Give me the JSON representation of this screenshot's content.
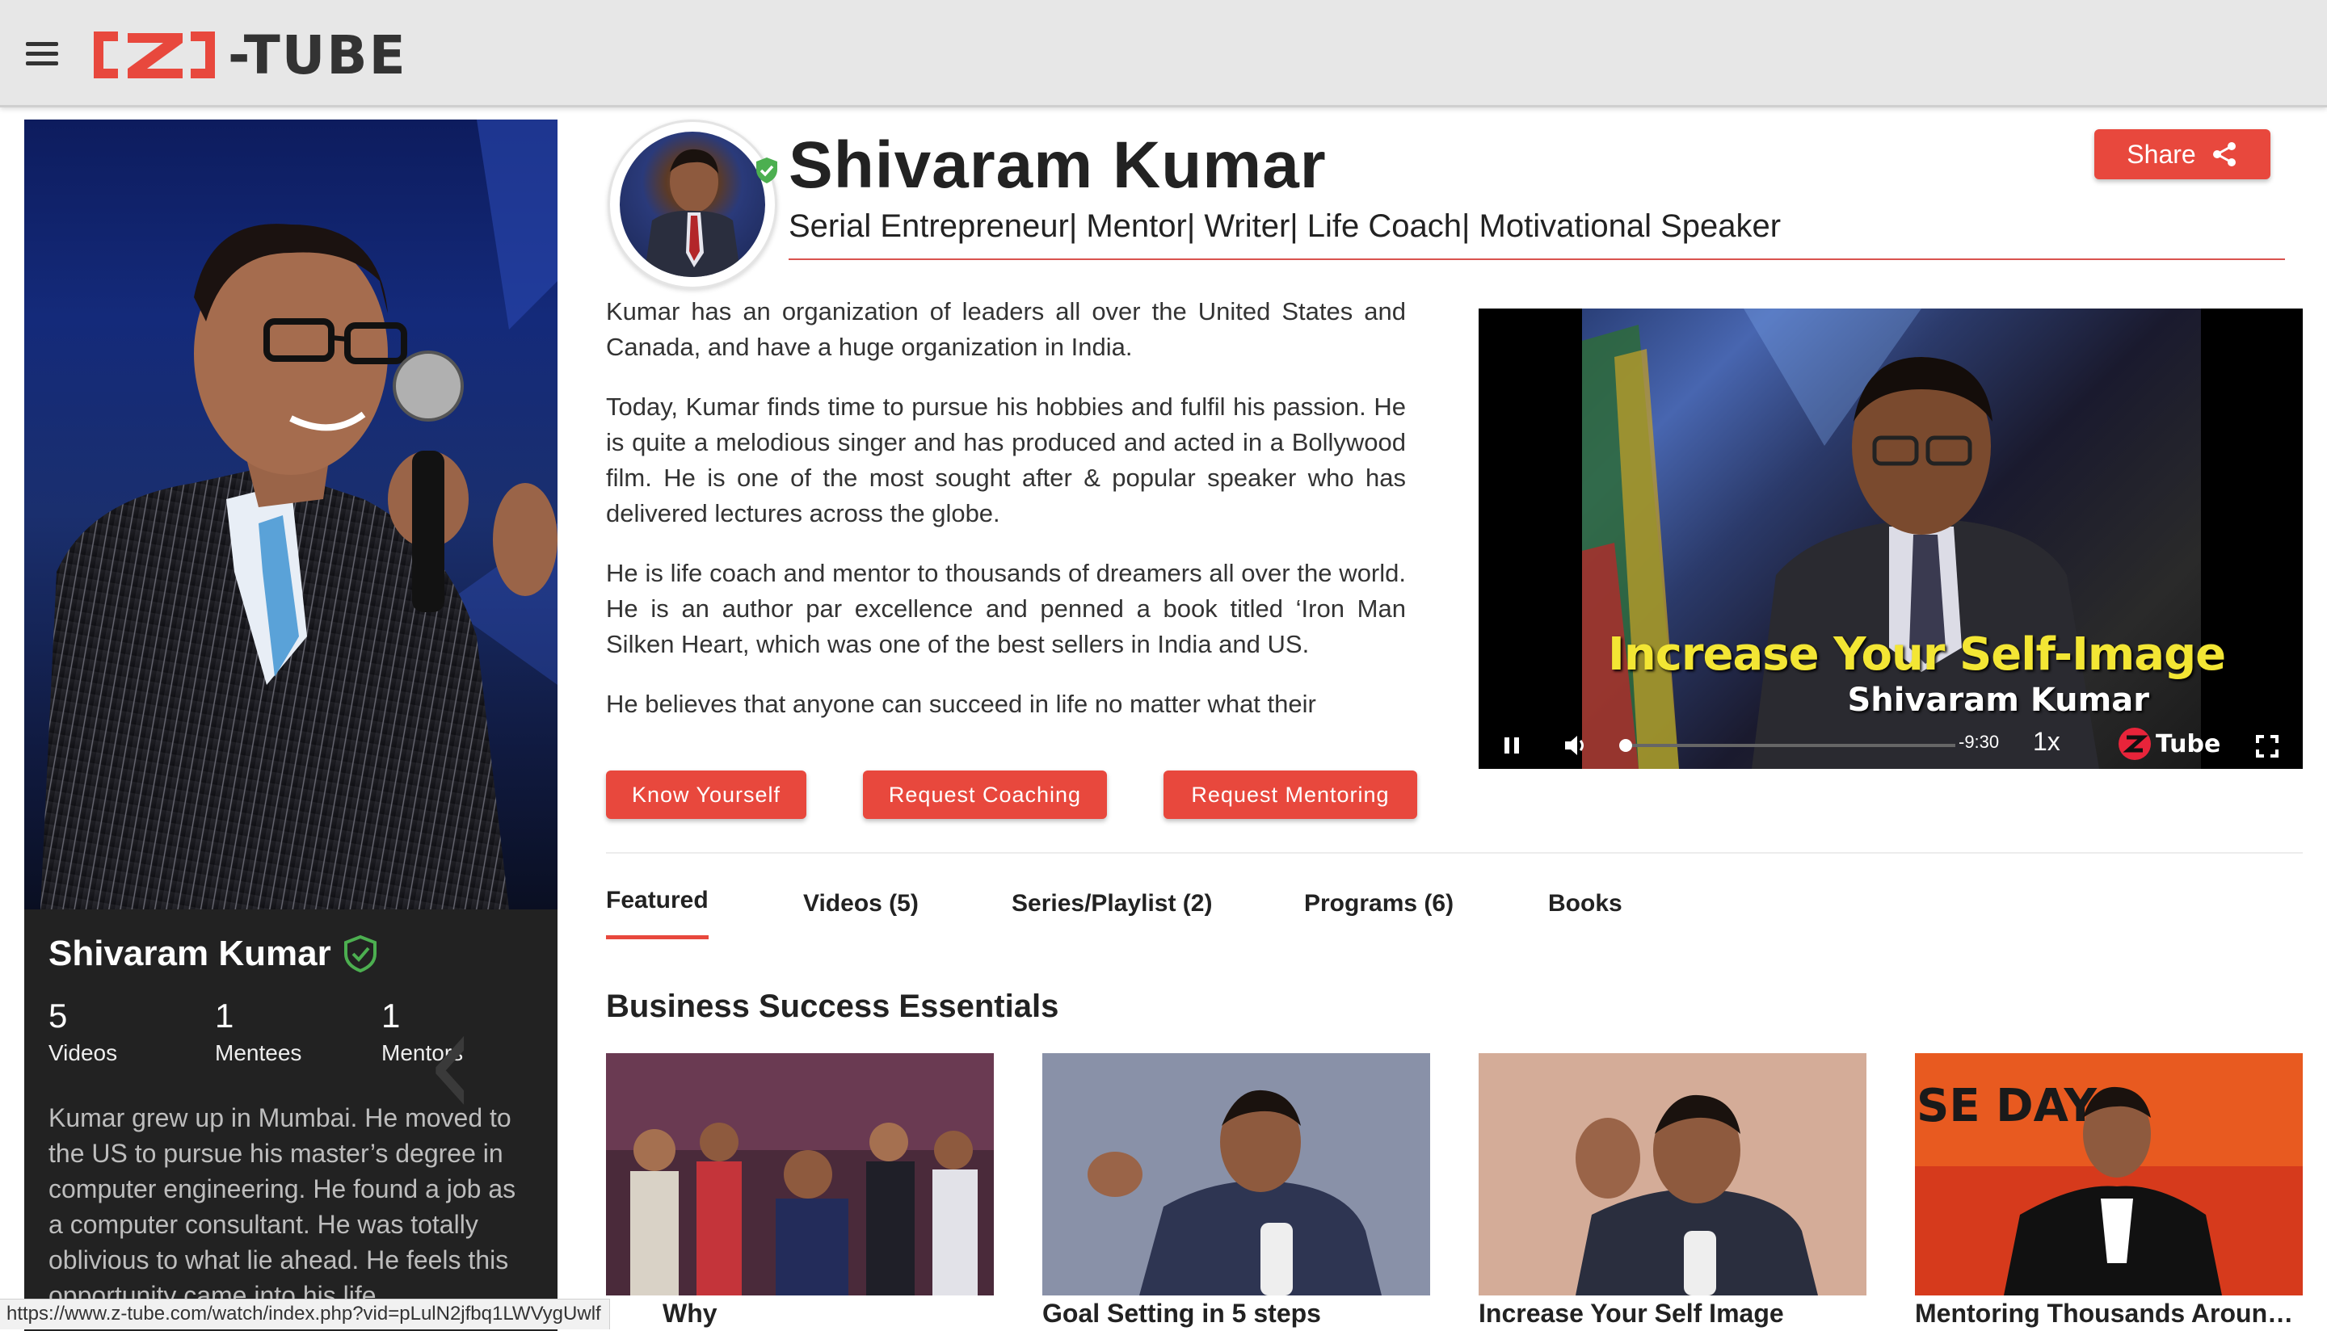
{
  "app": {
    "logo_text": "-TUBE",
    "logo_mark": "Z"
  },
  "profile": {
    "name": "Shivaram Kumar",
    "stats": [
      {
        "num": "5",
        "label": "Videos"
      },
      {
        "num": "1",
        "label": "Mentees"
      },
      {
        "num": "1",
        "label": "Mentors"
      }
    ],
    "bio": "Kumar grew up in Mumbai. He moved to the US to pursue his master’s degree in computer engineering. He found a job as a computer consultant. He was totally oblivious to what lie ahead. He feels this opportunity came into his life"
  },
  "header": {
    "name": "Shivaram Kumar",
    "tagline": "Serial Entrepreneur| Mentor| Writer| Life Coach| Motivational Speaker",
    "share_label": "Share"
  },
  "description": {
    "paragraphs": [
      "Kumar has an organization of leaders all over the United States and Canada, and have a huge organization in India.",
      "Today, Kumar finds time to pursue his hobbies and fulfil his passion. He is quite a melodious singer and has produced and acted in a Bollywood film. He is one of the most sought after & popular speaker who has delivered lectures across the globe.",
      "He is life coach and mentor to thousands of dreamers all over the world. He is an author par excellence and penned a book titled ‘Iron Man Silken Heart, which was one of the best sellers in India and US.",
      "He believes that anyone can succeed in life no matter what their"
    ]
  },
  "actions": {
    "know_yourself": "Know Yourself",
    "request_coaching": "Request Coaching",
    "request_mentoring": "Request Mentoring"
  },
  "video": {
    "title": "Increase Your Self-Image",
    "subtitle": "Shivaram Kumar",
    "time": "-9:30",
    "speed": "1x",
    "logo_text": "Tube",
    "progress": 0.0
  },
  "tabs": [
    {
      "label": "Featured",
      "active": true
    },
    {
      "label": "Videos (5)",
      "active": false
    },
    {
      "label": "Series/Playlist (2)",
      "active": false
    },
    {
      "label": "Programs (6)",
      "active": false
    },
    {
      "label": "Books",
      "active": false
    }
  ],
  "section": {
    "title": "Business Success Essentials"
  },
  "videos": [
    {
      "caption": "Why"
    },
    {
      "caption": "Goal Setting in 5 steps"
    },
    {
      "caption": "Increase Your Self Image"
    },
    {
      "caption": "Mentoring Thousands Aroun…"
    }
  ],
  "statusbar": {
    "url": "https://www.z-tube.com/watch/index.php?vid=pLulN2jfbq1LWVygUwlf"
  },
  "colors": {
    "accent": "#e8483d",
    "verified": "#4caf50"
  }
}
